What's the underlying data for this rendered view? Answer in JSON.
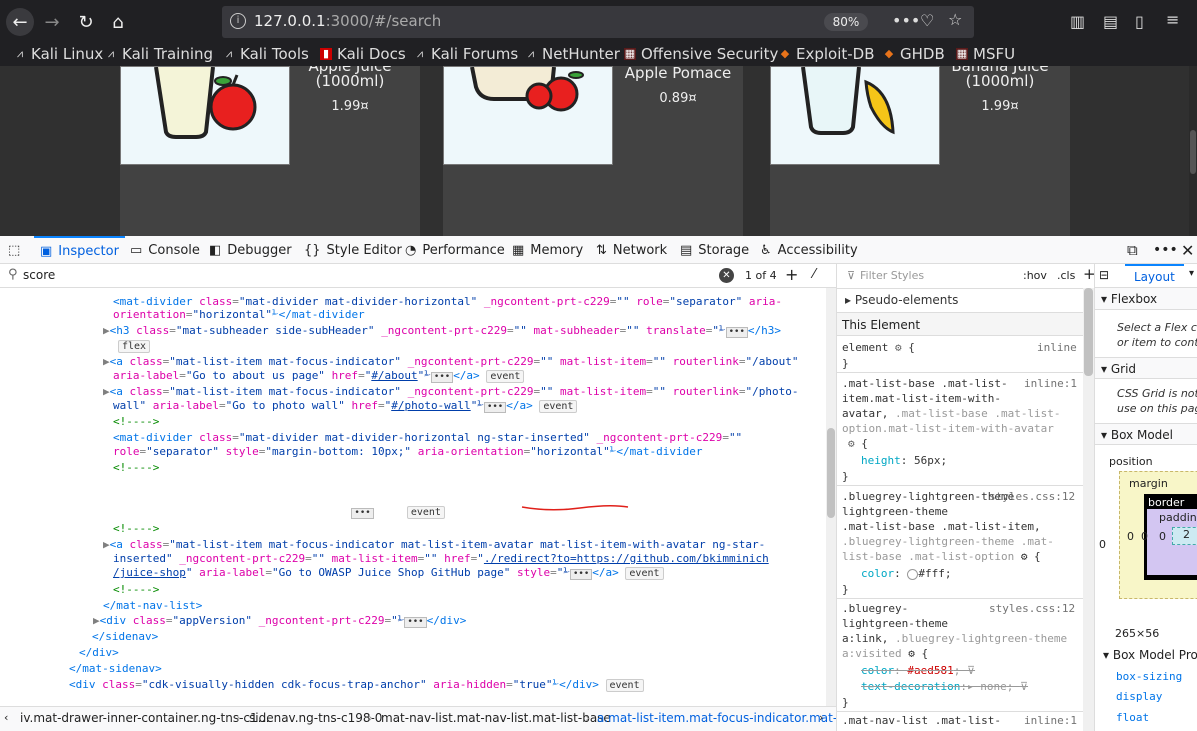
{
  "browser": {
    "url_host": "127.0.0.1",
    "url_rest": ":3000/#/search",
    "zoom": "80%",
    "info_icon": "i"
  },
  "bookmarks": [
    "Kali Linux",
    "Kali Training",
    "Kali Tools",
    "Kali Docs",
    "Kali Forums",
    "NetHunter",
    "Offensive Security",
    "Exploit-DB",
    "GHDB",
    "MSFU"
  ],
  "products": [
    {
      "name": "Apple Juice\n(1000ml)",
      "price": "1.99¤"
    },
    {
      "name": "Apple Pomace",
      "price": "0.89¤"
    },
    {
      "name": "Banana Juice\n(1000ml)",
      "price": "1.99¤"
    }
  ],
  "devtools": {
    "tabs": [
      "Inspector",
      "Console",
      "Debugger",
      "Style Editor",
      "Performance",
      "Memory",
      "Network",
      "Storage",
      "Accessibility"
    ],
    "search_value": "score",
    "match_count": "1 of 4",
    "filter_placeholder": "Filter Styles",
    "hov": ":hov",
    "cls": ".cls",
    "layout_tab": "Layout"
  },
  "breadcrumbs": [
    "iv.mat-drawer-inner-container.ng-tns-c1…",
    "sidenav.ng-tns-c198-0",
    "mat-nav-list.mat-nav-list.mat-list-base",
    "a.mat-list-item.mat-focus-indicator.mat-…"
  ],
  "rules": {
    "pseudo": "Pseudo-elements",
    "this_element": "This Element",
    "element_sel": "element",
    "inline": "inline",
    "inline1": "inline:1",
    "styles_src": "styles.css:12",
    "height_val": "56px",
    "color_val": "#fff",
    "visited_color": "#aed581",
    "text_dec_val": "none"
  },
  "layout": {
    "flexbox": "Flexbox",
    "flex_hint": "Select a Flex container or item to continue.",
    "grid": "Grid",
    "grid_hint": "CSS Grid is not in use on this page",
    "box_model": "Box Model",
    "position": "position",
    "margin": "margin",
    "border": "border",
    "padding": "padding",
    "zero": "0",
    "size": "265×56",
    "box_model_props": "Box Model Properties",
    "props": [
      "box-sizing",
      "display",
      "float"
    ]
  }
}
